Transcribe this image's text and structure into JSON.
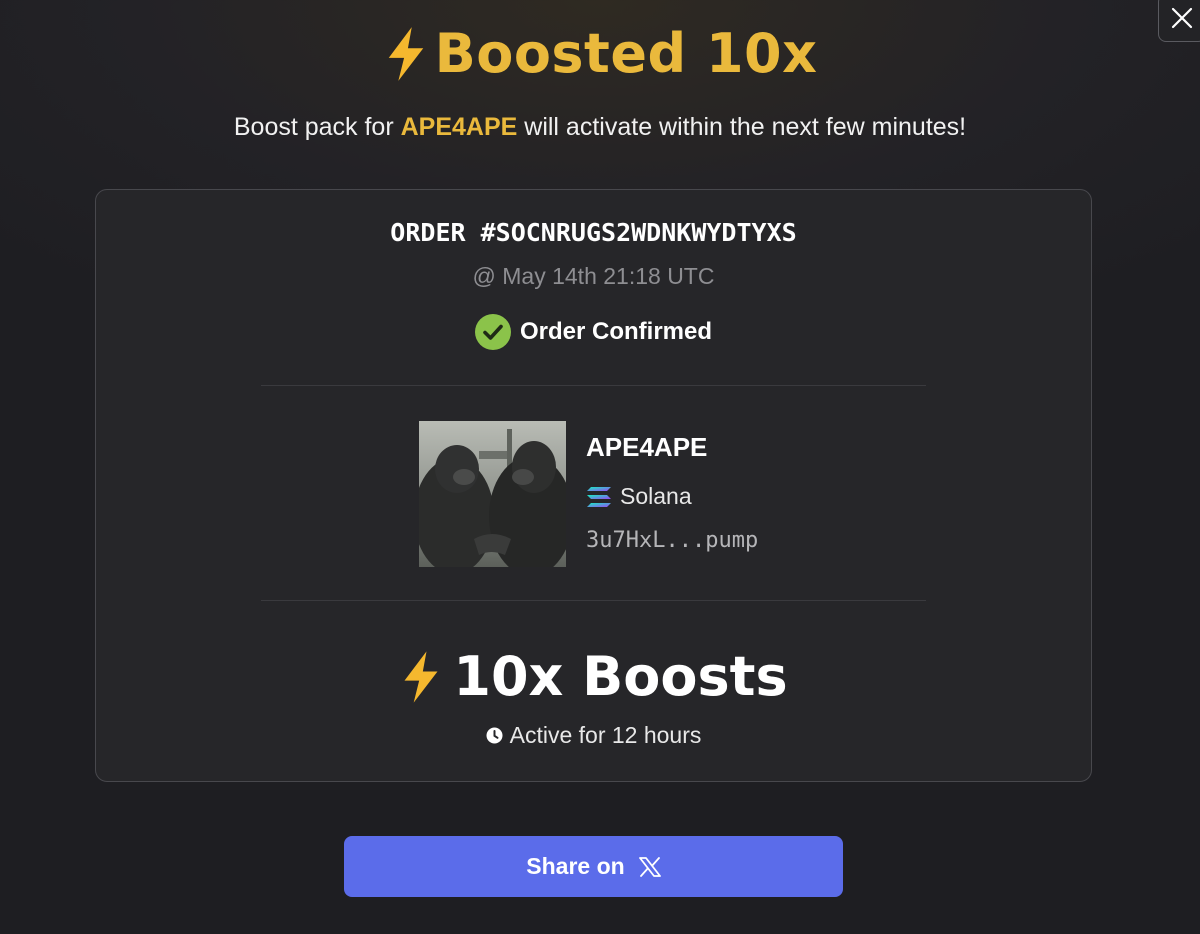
{
  "header": {
    "title": "Boosted 10x",
    "subtitle_prefix": "Boost pack for ",
    "token_highlight": "APE4APE",
    "subtitle_suffix": " will activate within the next few minutes!"
  },
  "order": {
    "id": "ORDER #SOCNRUGS2WDNKWYDTYXS",
    "timestamp": "@ May 14th 21:18 UTC",
    "status": "Order Confirmed"
  },
  "token": {
    "name": "APE4APE",
    "chain": "Solana",
    "address": "3u7HxL...pump",
    "image_icon": "gorillas-handshake-image"
  },
  "boost": {
    "label": "10x Boosts",
    "duration": "Active for 12 hours"
  },
  "share": {
    "label": "Share on"
  },
  "colors": {
    "accent": "#eab93c",
    "button": "#5b6cea",
    "success": "#8bc34a"
  }
}
